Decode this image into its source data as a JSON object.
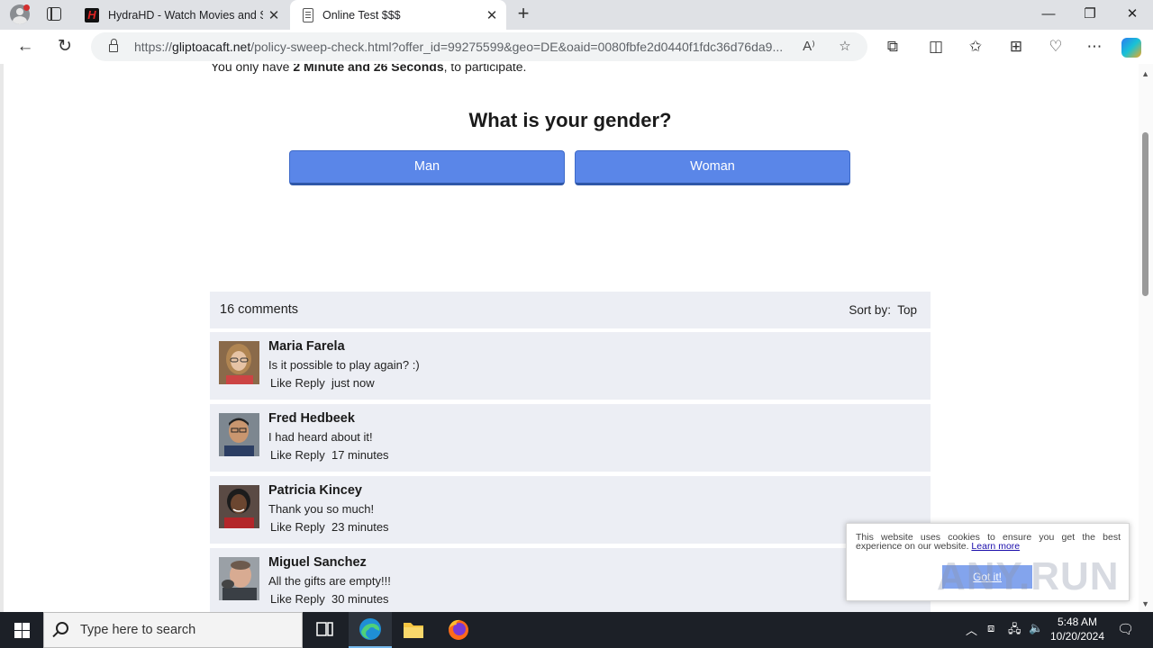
{
  "browser": {
    "tabs": [
      {
        "title": "HydraHD - Watch Movies and Se",
        "favicon_letter": "H"
      },
      {
        "title": "Online Test $$$"
      }
    ],
    "url_prefix": "https://",
    "url_host": "gliptoacaft.net",
    "url_rest": "/policy-sweep-check.html?offer_id=99275599&geo=DE&oaid=0080fbfe2d0440f1fdc36d76da9...",
    "icons": [
      "profile-icon",
      "tab-actions-icon",
      "close-icon",
      "new-tab-icon",
      "minimize-icon",
      "restore-icon",
      "close-window-icon",
      "back-icon",
      "refresh-icon",
      "lock-icon",
      "read-aloud-icon",
      "favorite-star-icon",
      "extensions-icon",
      "split-screen-icon",
      "favorites-icon",
      "collections-icon",
      "browser-essentials-icon",
      "more-icon",
      "copilot-icon"
    ]
  },
  "page": {
    "timer_prefix": "You only have ",
    "timer_value": "2 Minute and 26 Seconds",
    "timer_suffix": ", to participate.",
    "question": "What is your gender?",
    "answers": [
      "Man",
      "Woman"
    ],
    "comments_count": "16 comments",
    "sort_label": "Sort by:",
    "sort_value": "Top",
    "comments": [
      {
        "name": "Maria Farela",
        "text": "Is it possible to play again? :)",
        "like": "Like",
        "reply": "Reply",
        "time": "just now"
      },
      {
        "name": "Fred Hedbeek",
        "text": "I had heard about it!",
        "like": "Like",
        "reply": "Reply",
        "time": "17 minutes"
      },
      {
        "name": "Patricia Kincey",
        "text": "Thank you so much!",
        "like": "Like",
        "reply": "Reply",
        "time": "23 minutes"
      },
      {
        "name": "Miguel Sanchez",
        "text": "All the gifts are empty!!!",
        "like": "Like",
        "reply": "Reply",
        "time": "30 minutes"
      }
    ],
    "cookie": {
      "text": "This website uses cookies to ensure you get the best experience on our website.",
      "link": "Learn more",
      "button": "Got it!"
    },
    "watermark": "ANY.RUN"
  },
  "taskbar": {
    "search_placeholder": "Type here to search",
    "time": "5:48 AM",
    "date": "10/20/2024"
  },
  "colors": {
    "button_blue": "#5a86e8",
    "comment_bg": "#eceef4",
    "taskbar": "#1c2027"
  }
}
